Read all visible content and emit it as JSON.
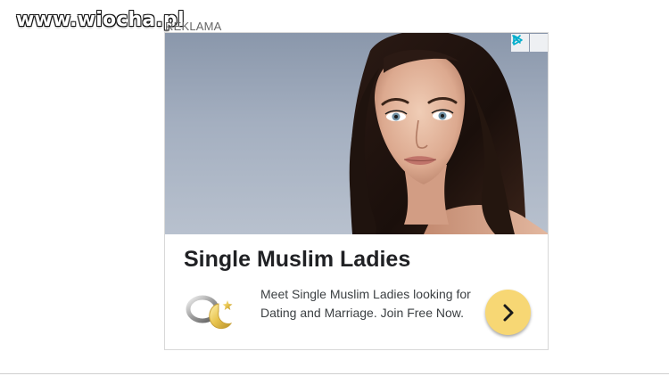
{
  "watermark": {
    "text": "www.wiocha.pl"
  },
  "ad": {
    "label": "REKLAMA",
    "headline": "Single Muslim Ladies",
    "description": "Meet Single Muslim Ladies looking for Dating and Marriage. Join Free Now.",
    "image_alt": "Woman portrait",
    "adchoices_icon": "adchoices-icon",
    "close_icon": "close-icon",
    "cta_icon": "chevron-right-icon",
    "logo_icon": "rings-crescent-icon"
  },
  "colors": {
    "cta_bg": "#f7d774",
    "adchoices_blue": "#00aecd",
    "text_dark": "#202124",
    "text_body": "#3c4043"
  }
}
